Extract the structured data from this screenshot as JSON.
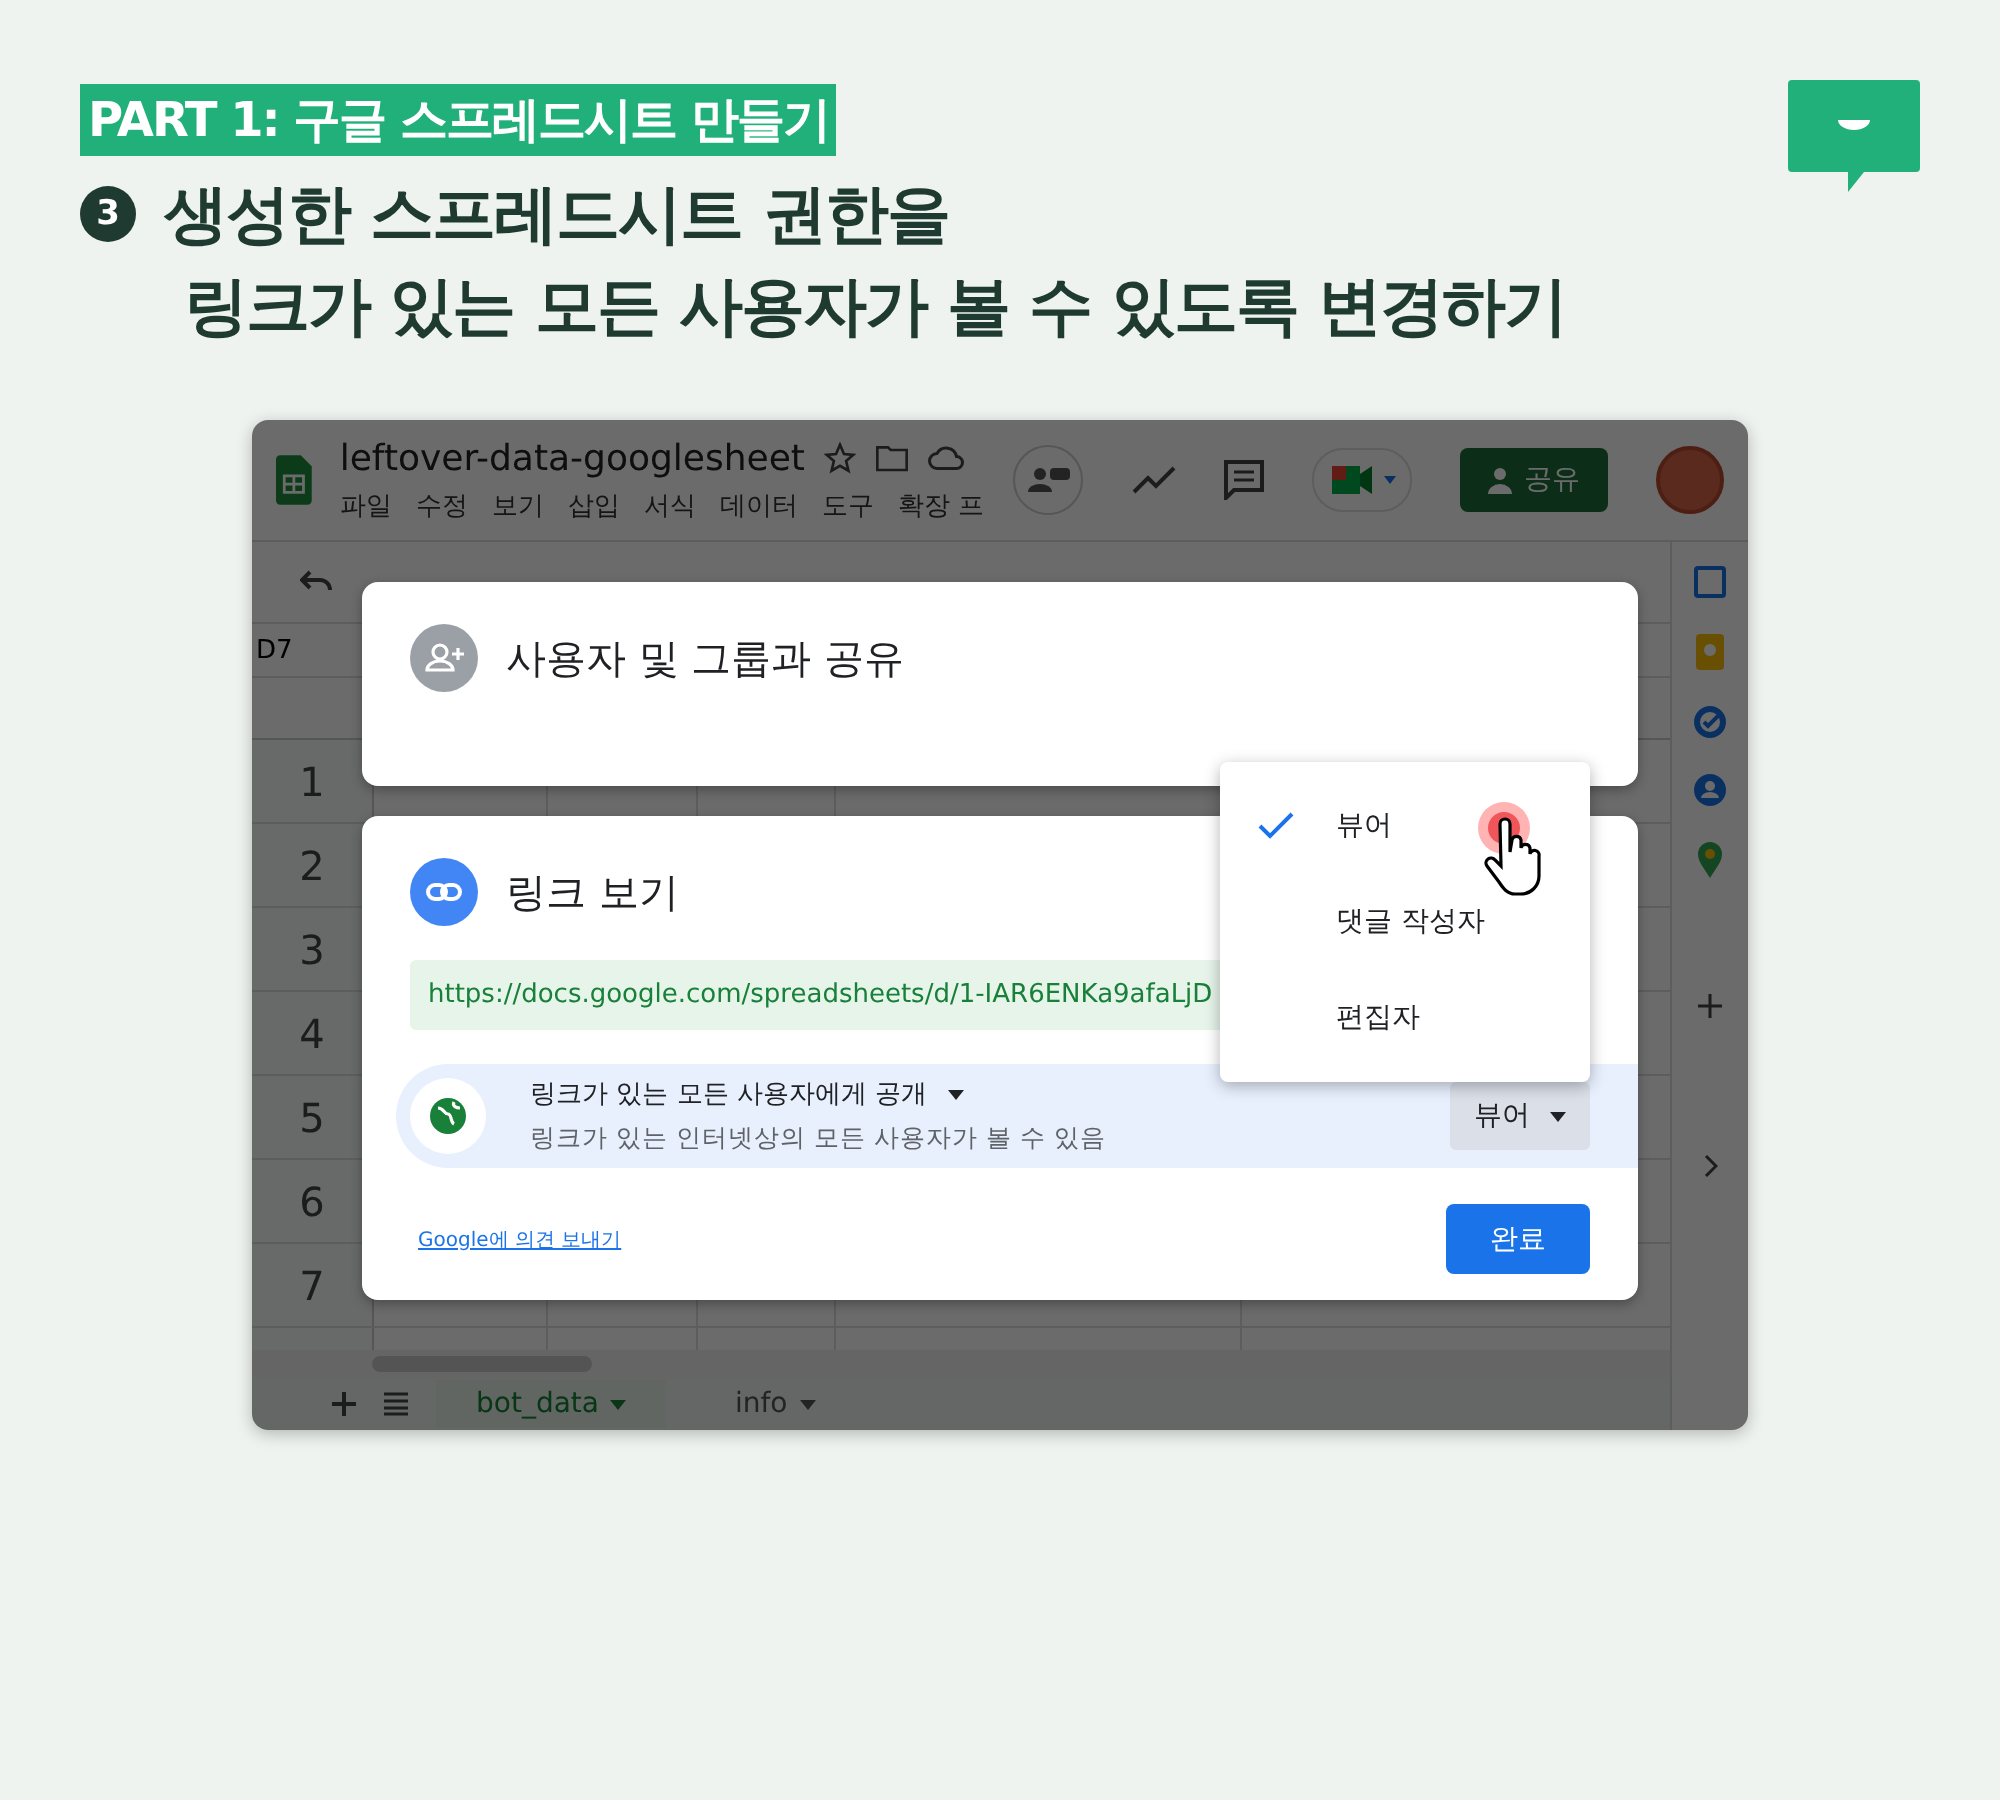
{
  "header": {
    "badge": "PART 1: 구글 스프레드시트 만들기",
    "step_number": "3",
    "title_lines": [
      "생성한 스프레드시트 권한을",
      "링크가 있는 모든 사용자가 볼 수 있도록 변경하기"
    ]
  },
  "sheet": {
    "title": "leftover-data-googlesheet",
    "menu": [
      "파일",
      "수정",
      "보기",
      "삽입",
      "서식",
      "데이터",
      "도구",
      "확장 프"
    ],
    "share_button": "공유",
    "cell_ref": "D7",
    "rows": [
      "1",
      "2",
      "3",
      "4",
      "5",
      "6",
      "7"
    ],
    "tabs": [
      {
        "label": "bot_data",
        "selected": true
      },
      {
        "label": "info",
        "selected": false
      }
    ]
  },
  "share_dialog": {
    "title": "사용자 및 그룹과 공유"
  },
  "link_dialog": {
    "title": "링크 보기",
    "url": "https://docs.google.com/spreadsheets/d/1-IAR6ENKa9afaLjD",
    "access": {
      "title": "링크가 있는 모든 사용자에게 공개",
      "description": "링크가 있는 인터넷상의 모든 사용자가 볼 수 있음",
      "role": "뷰어"
    },
    "feedback_link": "Google에 의견 보내기",
    "done_button": "완료"
  },
  "role_menu": [
    {
      "label": "뷰어",
      "selected": true
    },
    {
      "label": "댓글 작성자",
      "selected": false
    },
    {
      "label": "편집자",
      "selected": false
    }
  ]
}
